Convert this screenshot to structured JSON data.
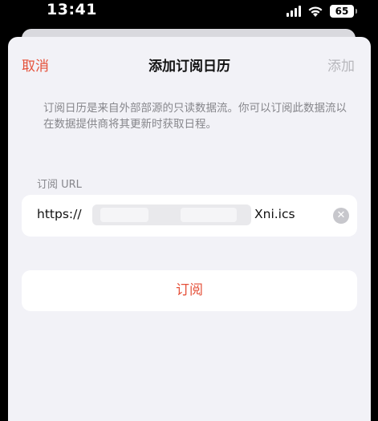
{
  "status_bar": {
    "time": "13:41",
    "battery": "65",
    "icons": [
      "signal-icon",
      "wifi-icon",
      "battery-icon"
    ]
  },
  "nav": {
    "cancel_label": "取消",
    "title": "添加订阅日历",
    "add_label": "添加"
  },
  "description": "订阅日历是来自外部部源的只读数据流。你可以订阅此数据流以在数据提供商将其更新时获取日程。",
  "url_section": {
    "label": "订阅 URL",
    "value_prefix": "https://",
    "value_suffix": "Xni.ics",
    "clear_icon": "clear-icon"
  },
  "subscribe_button": "订阅",
  "colors": {
    "accent": "#e5513a",
    "disabled": "#b7b7bc",
    "background": "#f2f2f7",
    "secondary_text": "#86868b"
  }
}
